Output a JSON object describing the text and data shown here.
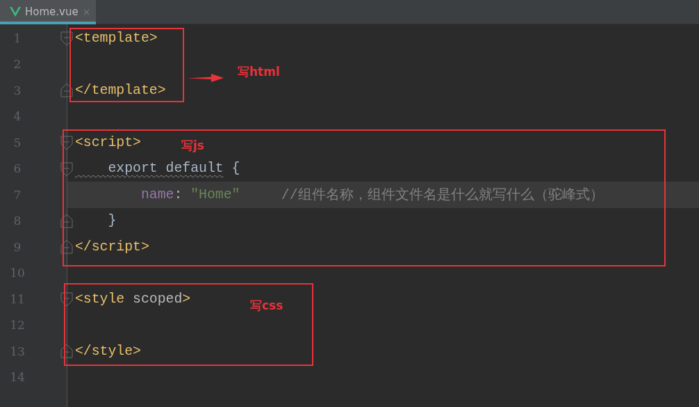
{
  "tabs": [
    {
      "label": "Home.vue",
      "selected": true,
      "close": "×"
    }
  ],
  "lines": [
    {
      "number": "1",
      "fold_start": true,
      "fold_end": false,
      "current": false,
      "tokens": [
        {
          "kind": "tag",
          "text": "<template>"
        }
      ]
    },
    {
      "number": "2",
      "fold_start": false,
      "fold_end": false,
      "current": false
    },
    {
      "number": "3",
      "fold_start": false,
      "fold_end": true,
      "current": false,
      "tokens": [
        {
          "kind": "tag",
          "text": "</template>"
        }
      ]
    },
    {
      "number": "4",
      "fold_start": false,
      "fold_end": false,
      "current": false
    },
    {
      "number": "5",
      "fold_start": true,
      "fold_end": false,
      "current": false,
      "tokens": [
        {
          "kind": "tag",
          "text": "<script>"
        }
      ]
    },
    {
      "number": "6",
      "fold_start": true,
      "fold_end": false,
      "current": false,
      "tokens": [
        {
          "kind": "flagged",
          "text": "    export default"
        },
        {
          "kind": "plain",
          "text": " {"
        }
      ]
    },
    {
      "number": "7",
      "fold_start": false,
      "fold_end": false,
      "current": true,
      "tokens": [
        {
          "kind": "prop",
          "text": "        name"
        },
        {
          "kind": "plain",
          "text": ": "
        },
        {
          "kind": "string",
          "text": "\"Home\""
        },
        {
          "kind": "comment",
          "text": "     //组件名称，组件文件名是什么就写什么（驼峰式）"
        }
      ]
    },
    {
      "number": "8",
      "fold_start": false,
      "fold_end": true,
      "current": false,
      "tokens": [
        {
          "kind": "plain",
          "text": "    }"
        }
      ]
    },
    {
      "number": "9",
      "fold_start": false,
      "fold_end": true,
      "current": false,
      "tokens": [
        {
          "kind": "tag",
          "text": "</script>"
        }
      ]
    },
    {
      "number": "10",
      "fold_start": false,
      "fold_end": false,
      "current": false
    },
    {
      "number": "11",
      "fold_start": true,
      "fold_end": false,
      "current": false,
      "tokens": [
        {
          "kind": "tag",
          "text": "<style"
        },
        {
          "kind": "attr",
          "text": " scoped"
        },
        {
          "kind": "tag",
          "text": ">"
        }
      ]
    },
    {
      "number": "12",
      "fold_start": false,
      "fold_end": false,
      "current": false
    },
    {
      "number": "13",
      "fold_start": false,
      "fold_end": true,
      "current": false,
      "tokens": [
        {
          "kind": "tag",
          "text": "</style>"
        }
      ]
    },
    {
      "number": "14",
      "fold_start": false,
      "fold_end": false,
      "current": false
    }
  ],
  "annotations": [
    {
      "label": "写html"
    },
    {
      "label": "写js"
    },
    {
      "label": "写css"
    }
  ]
}
